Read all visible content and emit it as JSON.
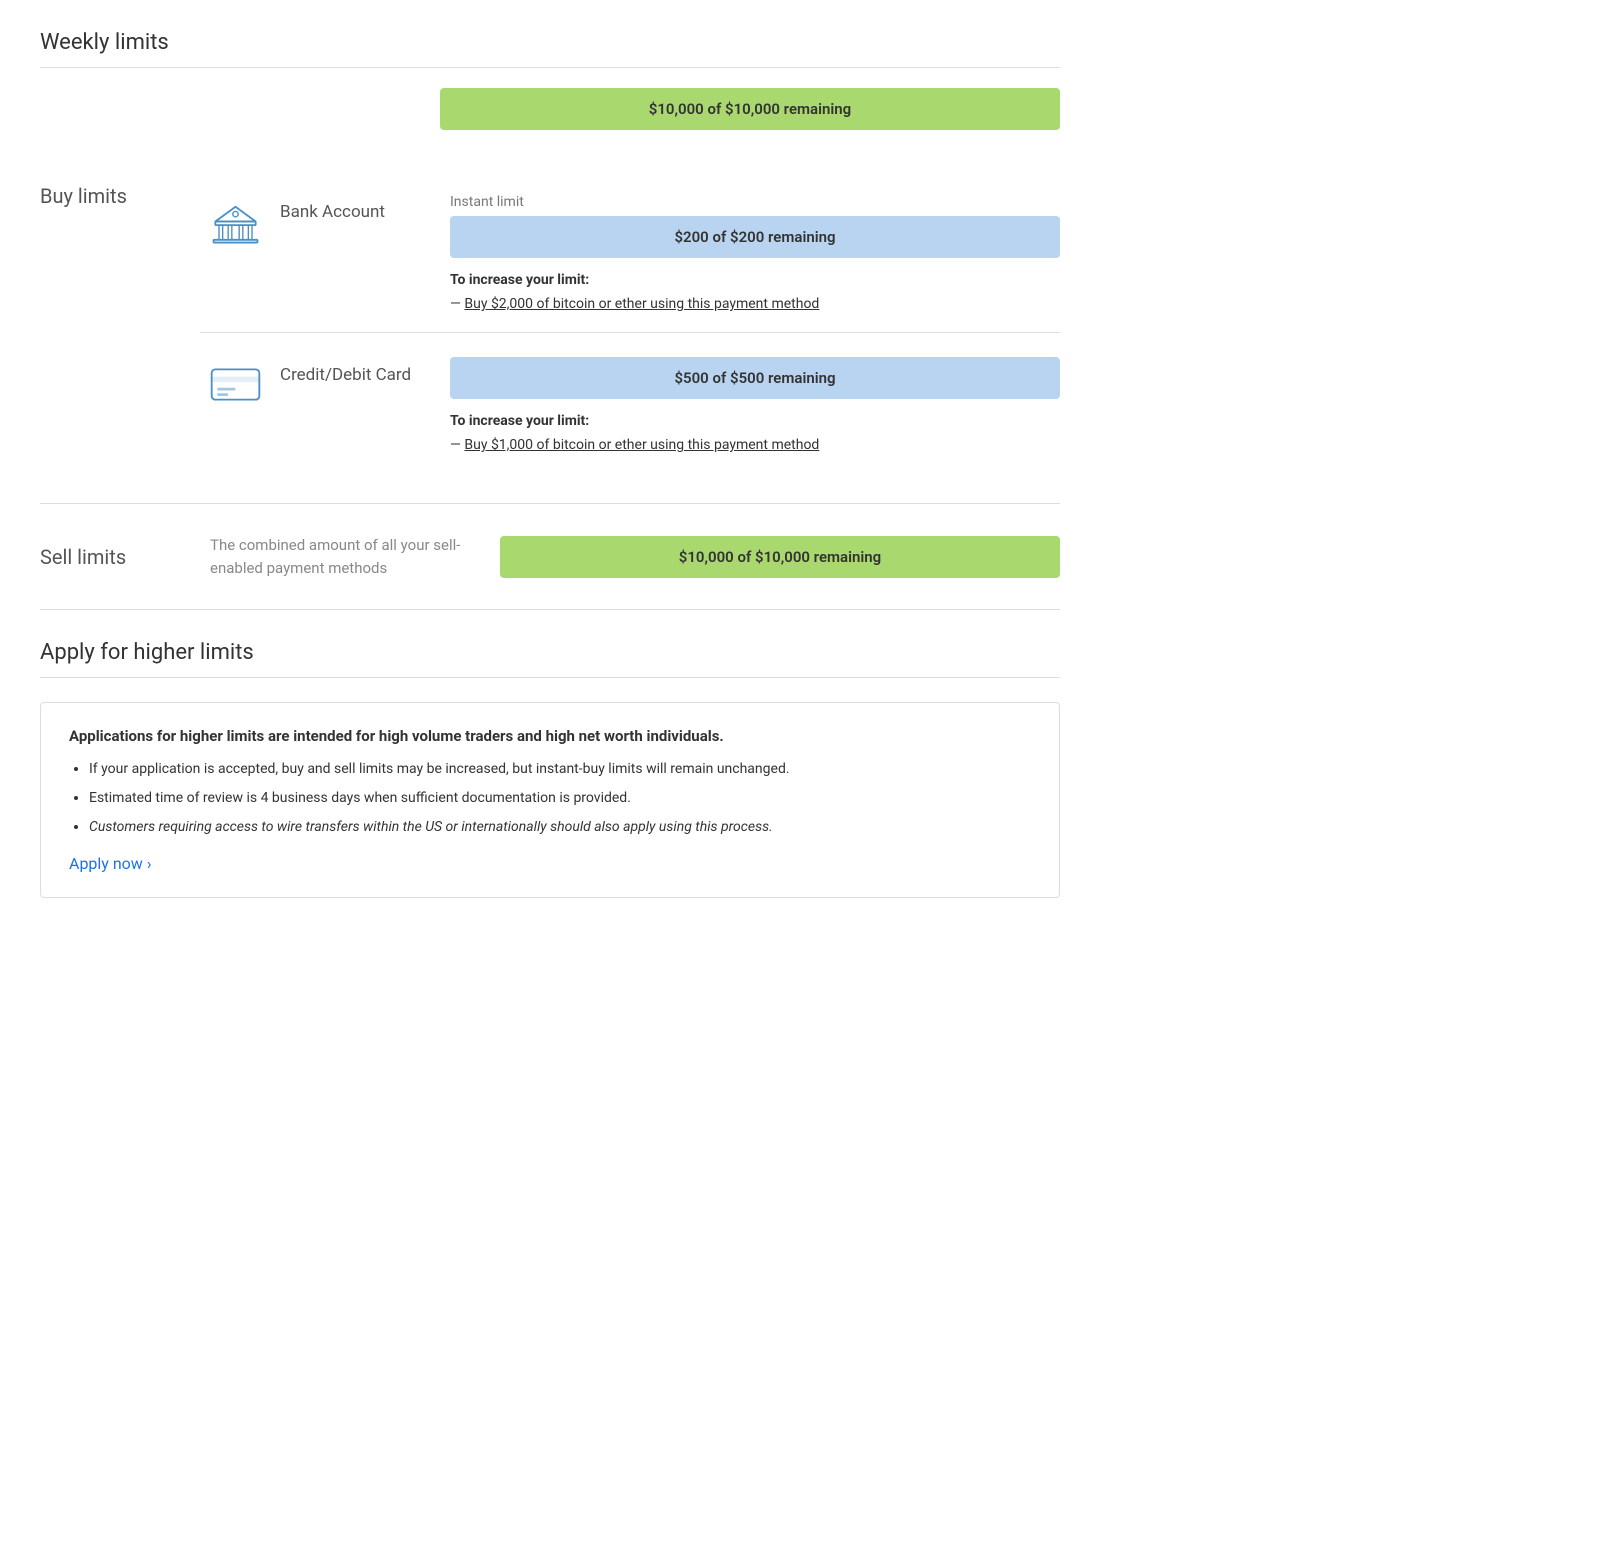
{
  "page": {
    "weekly_limits_title": "Weekly limits",
    "weekly_limit_bar": "$10,000 of $10,000 remaining",
    "buy_limits_label": "Buy limits",
    "bank_account": {
      "name": "Bank Account",
      "instant_limit_label": "Instant limit",
      "instant_limit_bar": "$200 of $200 remaining",
      "increase_label": "To increase your limit:",
      "increase_link_text": "Buy $2,000 of bitcoin or ether using this payment method"
    },
    "credit_card": {
      "name": "Credit/Debit Card",
      "limit_bar": "$500 of $500 remaining",
      "increase_label": "To increase your limit:",
      "increase_link_text": "Buy $1,000 of bitcoin or ether using this payment method"
    },
    "sell_limits": {
      "label": "Sell limits",
      "description": "The combined amount of all your sell-enabled payment methods",
      "limit_bar": "$10,000 of $10,000 remaining"
    },
    "apply_section": {
      "title": "Apply for higher limits",
      "box_title": "Applications for higher limits are intended for high volume traders and high net worth individuals.",
      "bullet_1": "If your application is accepted, buy and sell limits may be increased, but instant-buy limits will remain unchanged.",
      "bullet_2": "Estimated time of review is 4 business days when sufficient documentation is provided.",
      "bullet_3": "Customers requiring access to wire transfers within the US or internationally should also apply using this process.",
      "apply_now_text": "Apply now ›"
    }
  }
}
